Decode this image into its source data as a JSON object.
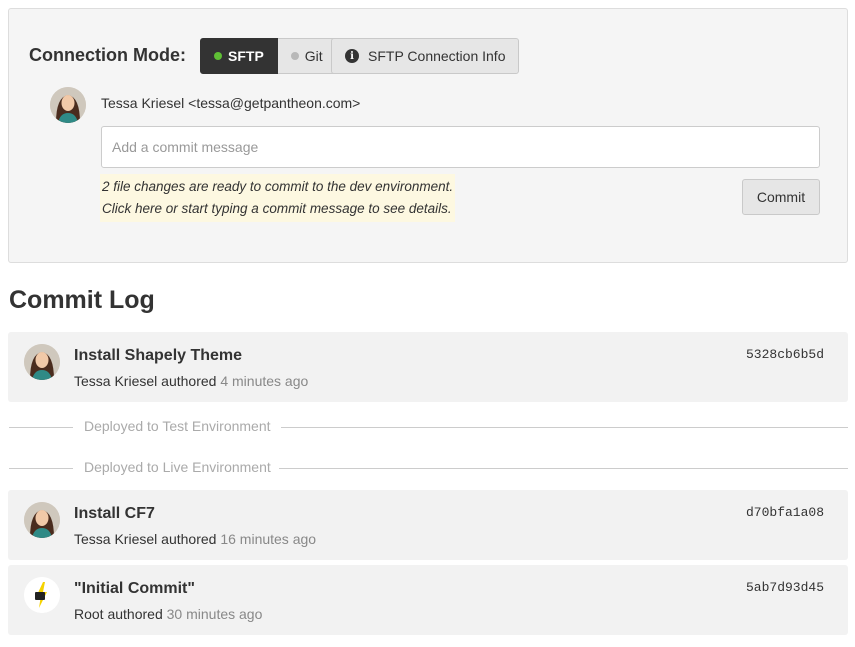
{
  "connection": {
    "label": "Connection Mode:",
    "modes": [
      {
        "label": "SFTP",
        "active": true,
        "dot_color": "#5fbf35"
      },
      {
        "label": "Git",
        "active": false,
        "dot_color": "#b8b8b8"
      }
    ],
    "info_button": "SFTP Connection Info"
  },
  "committer": {
    "author": "Tessa Kriesel <tessa@getpantheon.com>"
  },
  "commit_form": {
    "placeholder": "Add a commit message",
    "notice_line1": "2 file changes are ready to commit to the dev environment.",
    "notice_line2": "Click here or start typing a commit message to see details.",
    "commit_button": "Commit"
  },
  "commit_log": {
    "title": "Commit Log",
    "commits": [
      {
        "title": "Install Shapely Theme",
        "author": "Tessa Kriesel",
        "verb": "authored",
        "ago": "4 minutes ago",
        "hash": "5328cb6b5d"
      },
      {
        "title": "Install CF7",
        "author": "Tessa Kriesel",
        "verb": "authored",
        "ago": "16 minutes ago",
        "hash": "d70bfa1a08"
      },
      {
        "title": "\"Initial Commit\"",
        "author": "Root",
        "verb": "authored",
        "ago": "30 minutes ago",
        "hash": "5ab7d93d45"
      }
    ],
    "deployments": [
      {
        "label": "Deployed to Test Environment"
      },
      {
        "label": "Deployed to Live Environment"
      }
    ]
  },
  "colors": {
    "active_mode_bg": "#333333",
    "notice_bg": "#fdf8e1",
    "pantheon_yellow": "#f5d200"
  }
}
